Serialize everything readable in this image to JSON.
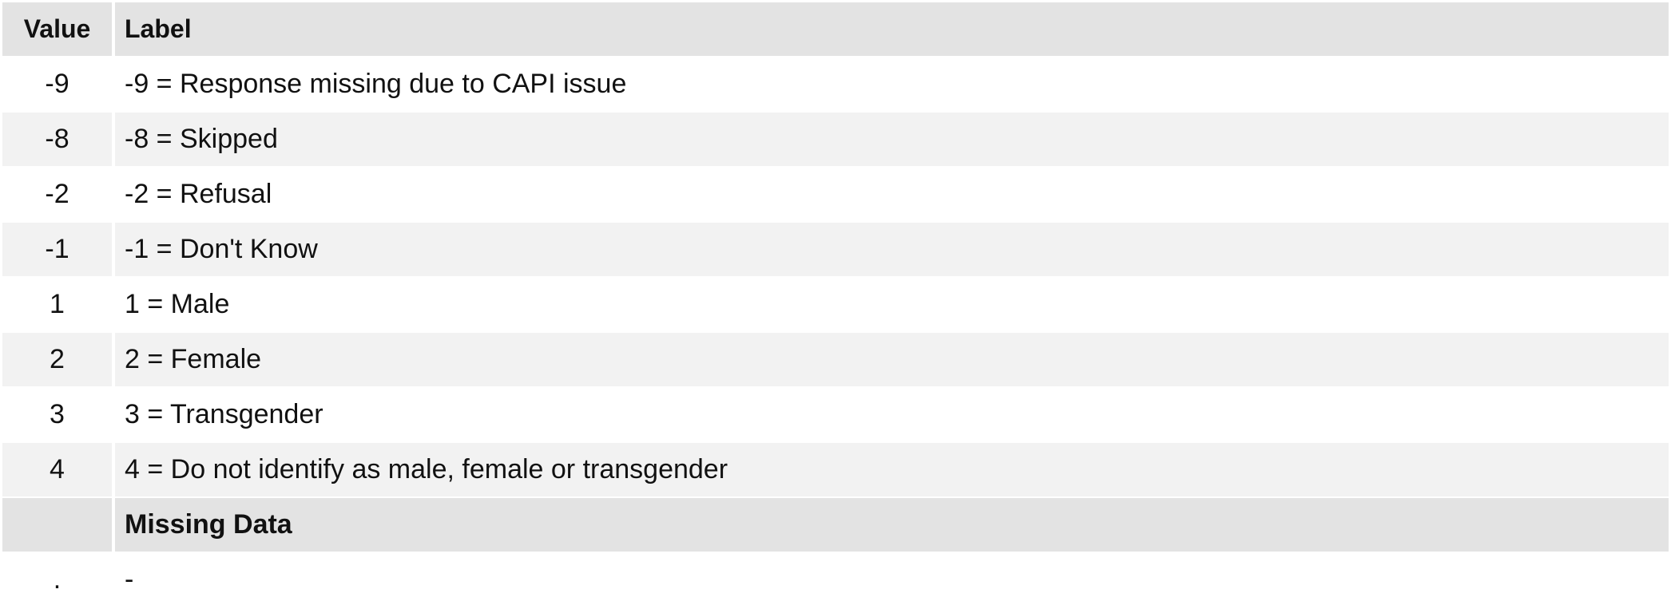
{
  "table": {
    "headers": {
      "value": "Value",
      "label": "Label"
    },
    "rows": [
      {
        "value": "-9",
        "label": "-9 = Response missing due to CAPI issue"
      },
      {
        "value": "-8",
        "label": "-8 = Skipped"
      },
      {
        "value": "-2",
        "label": "-2 = Refusal"
      },
      {
        "value": "-1",
        "label": "-1 = Don't Know"
      },
      {
        "value": "1",
        "label": "1 = Male"
      },
      {
        "value": "2",
        "label": "2 = Female"
      },
      {
        "value": "3",
        "label": "3 = Transgender"
      },
      {
        "value": "4",
        "label": "4 = Do not identify as male, female or transgender"
      }
    ],
    "missing_section": {
      "title": "Missing Data",
      "rows": [
        {
          "value": ".",
          "label": "-"
        }
      ]
    }
  },
  "colors": {
    "header_bg": "#e3e3e3",
    "row_alt_bg": "#f2f2f2",
    "row_bg": "#ffffff"
  }
}
